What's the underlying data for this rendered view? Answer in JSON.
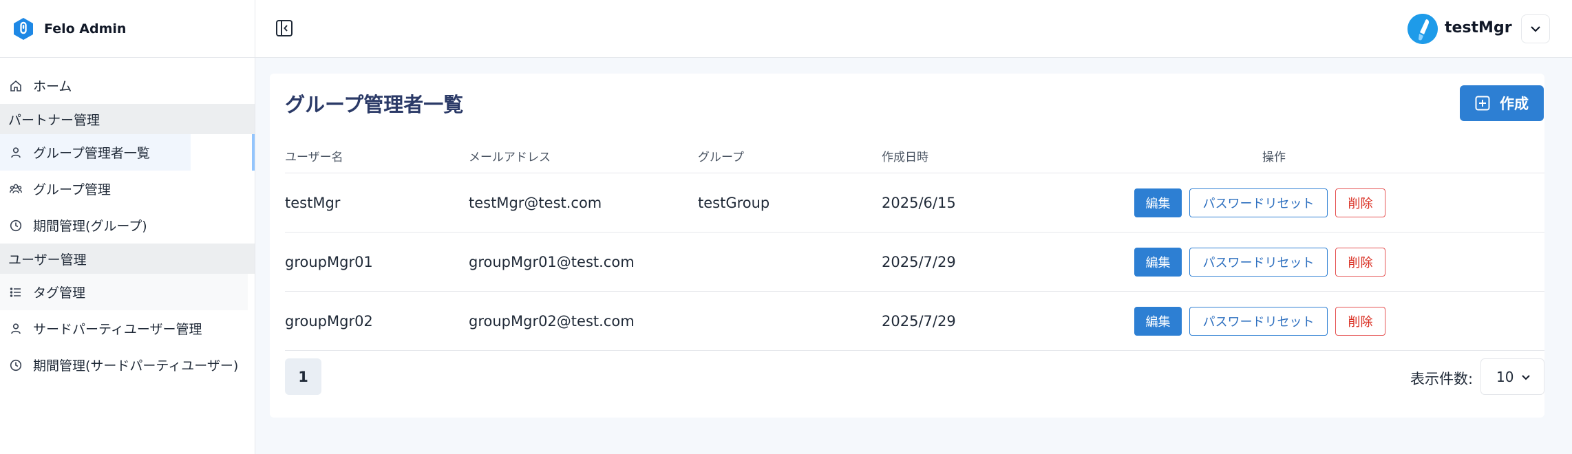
{
  "brand": {
    "name": "Felo Admin"
  },
  "sidebar": {
    "items": [
      {
        "type": "item",
        "label": "ホーム",
        "icon": "home-icon"
      },
      {
        "type": "section",
        "label": "パートナー管理"
      },
      {
        "type": "item",
        "label": "グループ管理者一覧",
        "icon": "user-icon",
        "active": true
      },
      {
        "type": "item",
        "label": "グループ管理",
        "icon": "users-icon"
      },
      {
        "type": "item",
        "label": "期間管理(グループ)",
        "icon": "clock-icon"
      },
      {
        "type": "section",
        "label": "ユーザー管理"
      },
      {
        "type": "item",
        "label": "タグ管理",
        "icon": "list-icon"
      },
      {
        "type": "item",
        "label": "サードパーティユーザー管理",
        "icon": "user-icon"
      },
      {
        "type": "item",
        "label": "期間管理(サードパーティユーザー)",
        "icon": "clock-icon"
      }
    ]
  },
  "header": {
    "user_name": "testMgr"
  },
  "main": {
    "title": "グループ管理者一覧",
    "create_label": "作成",
    "columns": [
      "ユーザー名",
      "メールアドレス",
      "グループ",
      "作成日時",
      "操作"
    ],
    "rows": [
      {
        "username": "testMgr",
        "email": "testMgr@test.com",
        "group": "testGroup",
        "created": "2025/6/15"
      },
      {
        "username": "groupMgr01",
        "email": "groupMgr01@test.com",
        "group": "",
        "created": "2025/7/29"
      },
      {
        "username": "groupMgr02",
        "email": "groupMgr02@test.com",
        "group": "",
        "created": "2025/7/29"
      }
    ],
    "actions": {
      "edit": "編集",
      "reset": "パスワードリセット",
      "delete": "削除"
    },
    "pagination": {
      "current_page": "1",
      "per_page_label": "表示件数:",
      "per_page_value": "10"
    }
  },
  "colors": {
    "primary": "#2d7fd3",
    "danger": "#d92d20",
    "title": "#2b3a67",
    "logo": "#1e88e5"
  }
}
